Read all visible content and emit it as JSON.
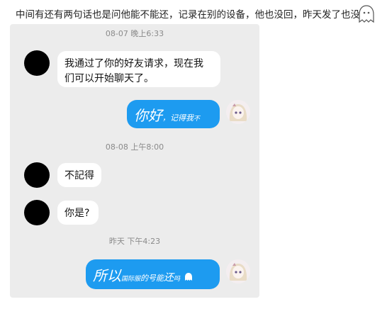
{
  "caption": "中间有还有两句话也是问他能不能还，记录在别的设备，他也没回，昨天发了也没回",
  "timestamps": [
    "08-07 晚上6:33",
    "08-08 上午8:00",
    "昨天 下午4:23"
  ],
  "messages": {
    "m1_line1": "我通过了你的好友请求，现在我",
    "m1_line2": "们可以开始聊天了。",
    "m2_big": "你好",
    "m2_small_a": "，记得",
    "m2_small_b": "我",
    "m2_tiny": "不",
    "m3": "不記得",
    "m4": "你是?",
    "m5_big1": "所",
    "m5_big2": "以",
    "m5_tiny1": "国际服",
    "m5_small1": "的号能",
    "m5_mid": "还",
    "m5_tiny2": "吗"
  },
  "colors": {
    "outgoing_bubble": "#1d9bf0",
    "incoming_bubble": "#ffffff",
    "chat_bg": "#ececec"
  },
  "icons": {
    "caption_icon": "ghost-icon",
    "emoji_icon": "ghost-emoji-icon"
  }
}
